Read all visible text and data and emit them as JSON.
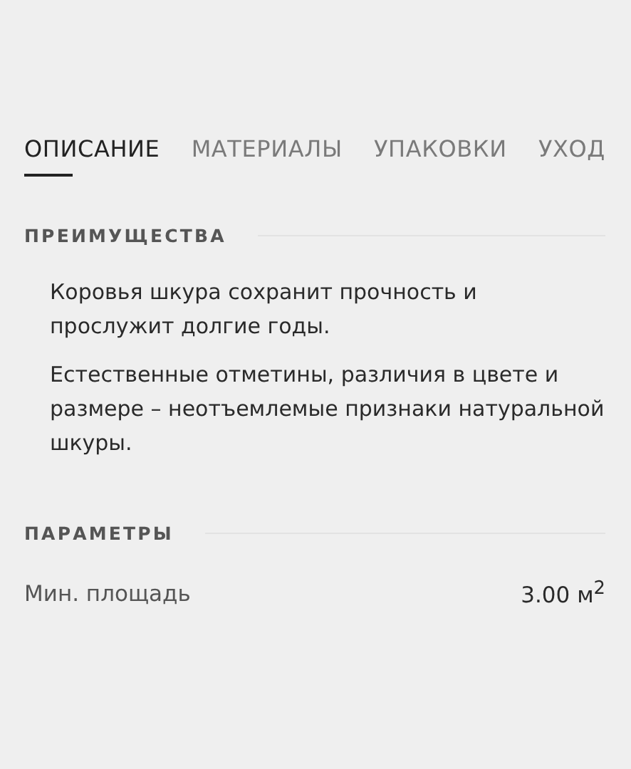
{
  "tabs": [
    {
      "label": "ОПИСАНИЕ",
      "selected": true
    },
    {
      "label": "МАТЕРИАЛЫ",
      "selected": false
    },
    {
      "label": "УПАКОВКИ",
      "selected": false
    },
    {
      "label": "УХОД",
      "selected": false
    }
  ],
  "advantages": {
    "title": "ПРЕИМУЩЕСТВА",
    "paragraphs": [
      "Коровья шкура сохранит прочность и прослужит долгие годы.",
      "Естественные отметины, различия в цвете и размере – неотъемлемые признаки натуральной шкуры."
    ]
  },
  "parameters": {
    "title": "ПАРАМЕТРЫ",
    "rows": [
      {
        "label": "Мин. площадь",
        "value": "3.00 м$^{2}$"
      }
    ]
  }
}
